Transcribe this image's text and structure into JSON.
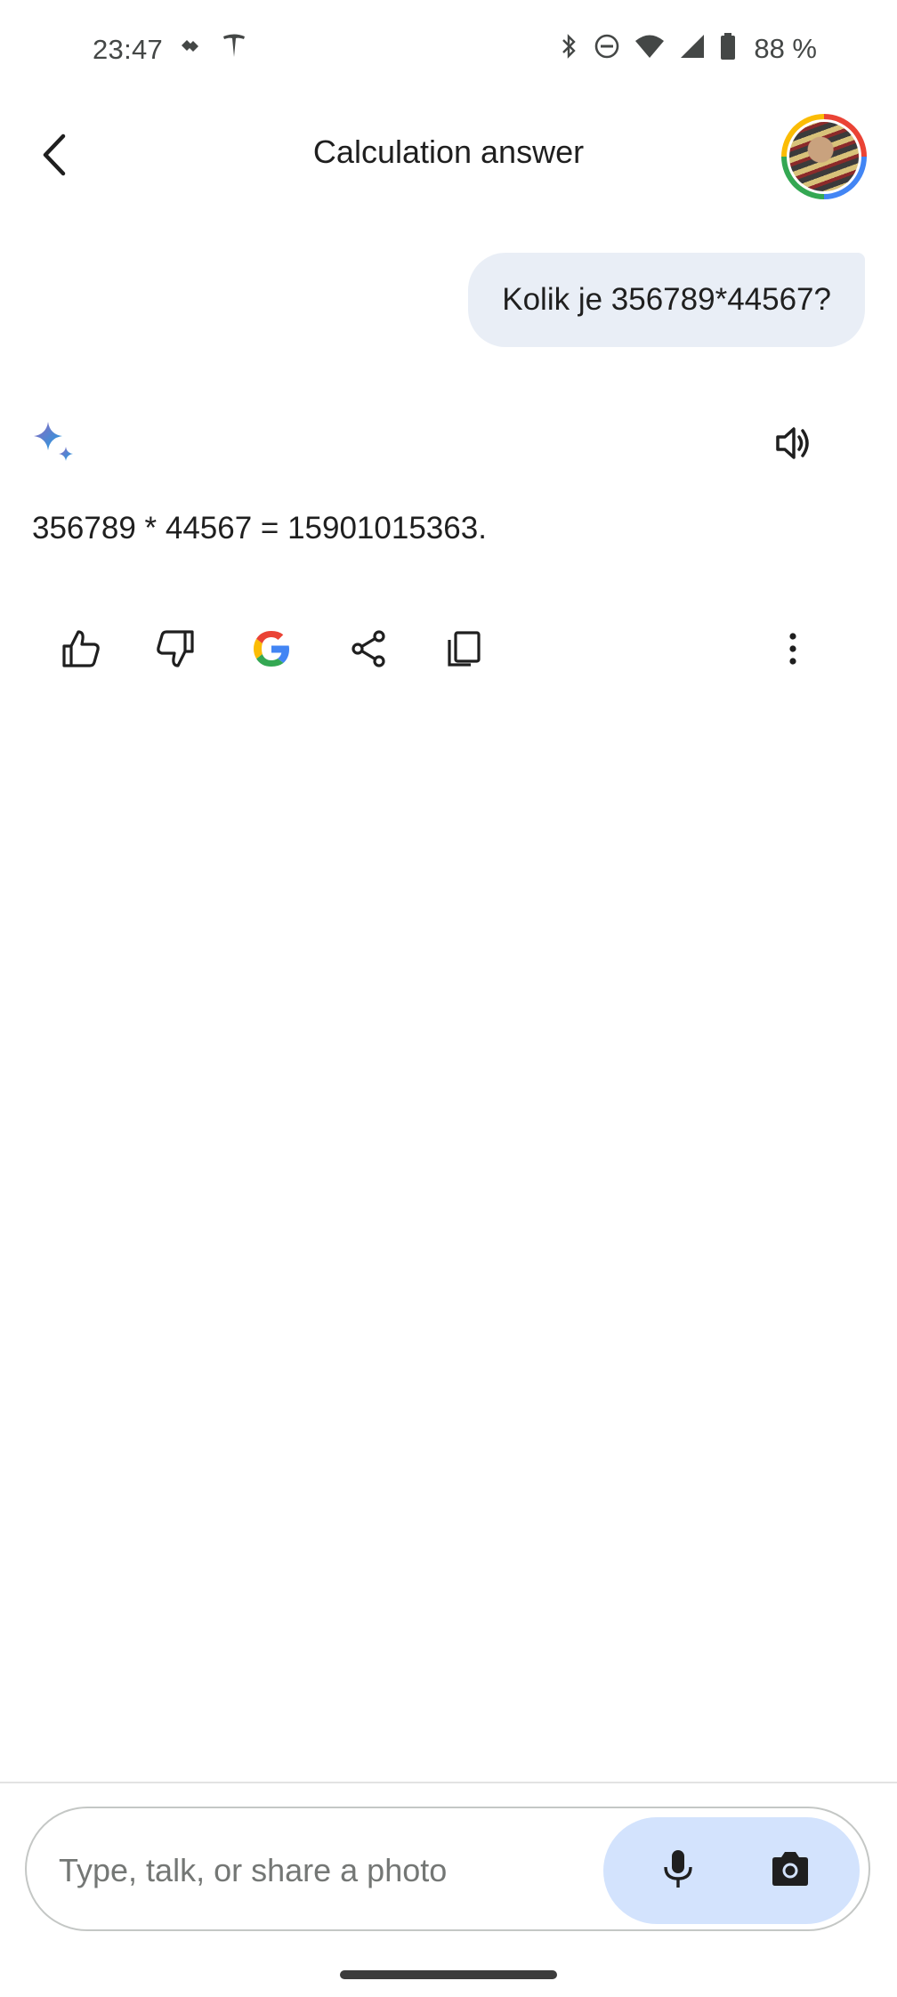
{
  "status_bar": {
    "time": "23:47",
    "battery_percent": "88 %",
    "icons": [
      "tidal-icon",
      "tesla-icon",
      "bluetooth-icon",
      "do-not-disturb-icon",
      "wifi-icon",
      "signal-icon",
      "battery-icon"
    ]
  },
  "header": {
    "title": "Calculation answer",
    "back_icon": "arrow-back-icon",
    "avatar": "user-avatar"
  },
  "conversation": {
    "user_message": "Kolik je 356789*44567?",
    "response_text": "356789 * 44567 = 15901015363.",
    "response_icon": "gemini-sparkle-icon",
    "speak_icon": "speaker-icon"
  },
  "actions": [
    "thumbs-up-icon",
    "thumbs-down-icon",
    "google-search-icon",
    "share-icon",
    "copy-icon",
    "more-vert-icon"
  ],
  "composer": {
    "placeholder": "Type, talk, or share a photo",
    "value": "",
    "mic_icon": "mic-icon",
    "camera_icon": "camera-icon"
  },
  "colors": {
    "user_bubble": "#e9eef6",
    "composer_actions": "#d3e3fd",
    "text": "#1f1f1f",
    "icon": "#444746"
  }
}
